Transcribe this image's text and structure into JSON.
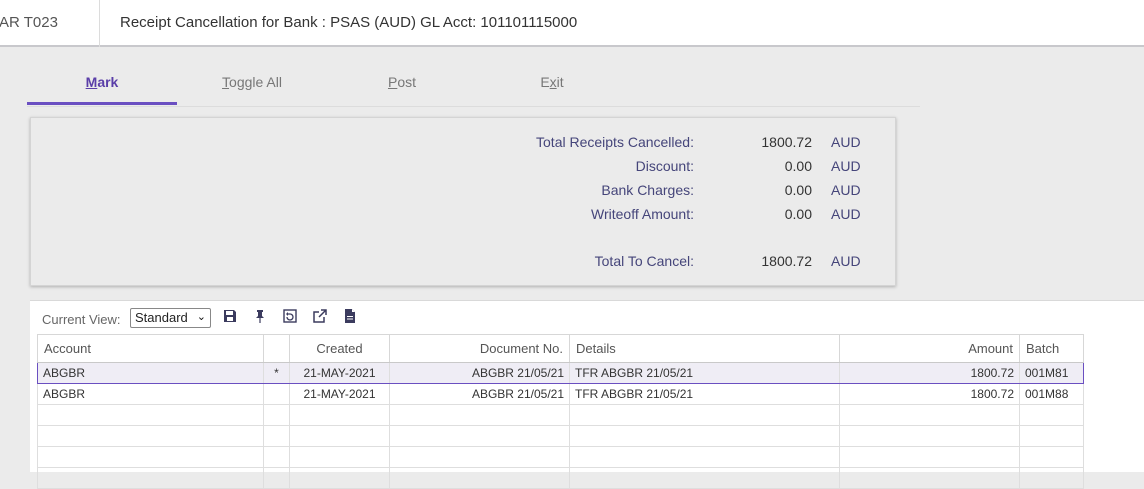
{
  "header": {
    "code": "AR T023",
    "title": "Receipt Cancellation for Bank : PSAS (AUD) GL Acct: 101101115000"
  },
  "tabs": [
    {
      "pre": "",
      "key": "M",
      "post": "ark",
      "active": true
    },
    {
      "pre": "",
      "key": "T",
      "post": "oggle All",
      "active": false
    },
    {
      "pre": "",
      "key": "P",
      "post": "ost",
      "active": false
    },
    {
      "pre": "E",
      "key": "x",
      "post": "it",
      "active": false
    }
  ],
  "summary": {
    "total_receipts_cancelled": {
      "label": "Total Receipts Cancelled:",
      "value": "1800.72",
      "currency": "AUD"
    },
    "discount": {
      "label": "Discount:",
      "value": "0.00",
      "currency": "AUD"
    },
    "bank_charges": {
      "label": "Bank Charges:",
      "value": "0.00",
      "currency": "AUD"
    },
    "writeoff_amount": {
      "label": "Writeoff Amount:",
      "value": "0.00",
      "currency": "AUD"
    },
    "total_to_cancel": {
      "label": "Total To Cancel:",
      "value": "1800.72",
      "currency": "AUD"
    }
  },
  "toolbar": {
    "current_view_label": "Current View:",
    "current_view_value": "Standard",
    "icons": [
      "save-icon",
      "pin-icon",
      "restore-icon",
      "export-icon",
      "document-icon"
    ]
  },
  "grid": {
    "columns": [
      "Account",
      "",
      "Created",
      "Document No.",
      "Details",
      "Amount",
      "Batch"
    ],
    "rows": [
      {
        "account": "ABGBR",
        "mark": "*",
        "created": "21-MAY-2021",
        "document_no": "ABGBR 21/05/21",
        "details": "TFR ABGBR 21/05/21",
        "amount": "1800.72",
        "batch": "001M81",
        "selected": true
      },
      {
        "account": "ABGBR",
        "mark": "",
        "created": "21-MAY-2021",
        "document_no": "ABGBR 21/05/21",
        "details": "TFR ABGBR 21/05/21",
        "amount": "1800.72",
        "batch": "001M88",
        "selected": false
      }
    ],
    "empty_rows": 4
  },
  "colors": {
    "accent": "#6a4fc1",
    "label": "#45457a",
    "background": "#ebebeb"
  }
}
